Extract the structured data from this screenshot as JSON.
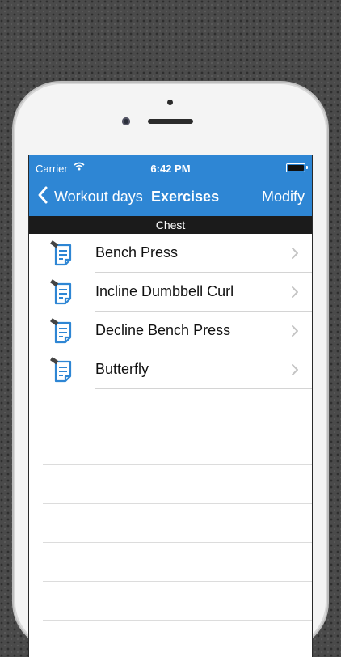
{
  "status_bar": {
    "carrier": "Carrier",
    "time": "6:42 PM"
  },
  "nav": {
    "back_label": "Workout days",
    "title": "Exercises",
    "action": "Modify"
  },
  "section": {
    "title": "Chest"
  },
  "exercises": [
    {
      "label": "Bench Press",
      "icon": "exercise-note-icon"
    },
    {
      "label": "Incline Dumbbell Curl",
      "icon": "exercise-note-icon"
    },
    {
      "label": "Decline Bench Press",
      "icon": "exercise-note-icon"
    },
    {
      "label": "Butterfly",
      "icon": "exercise-note-icon"
    }
  ],
  "colors": {
    "nav_bar": "#2e86d4",
    "section_header": "#1b1b1b",
    "icon": "#2e86d4"
  }
}
